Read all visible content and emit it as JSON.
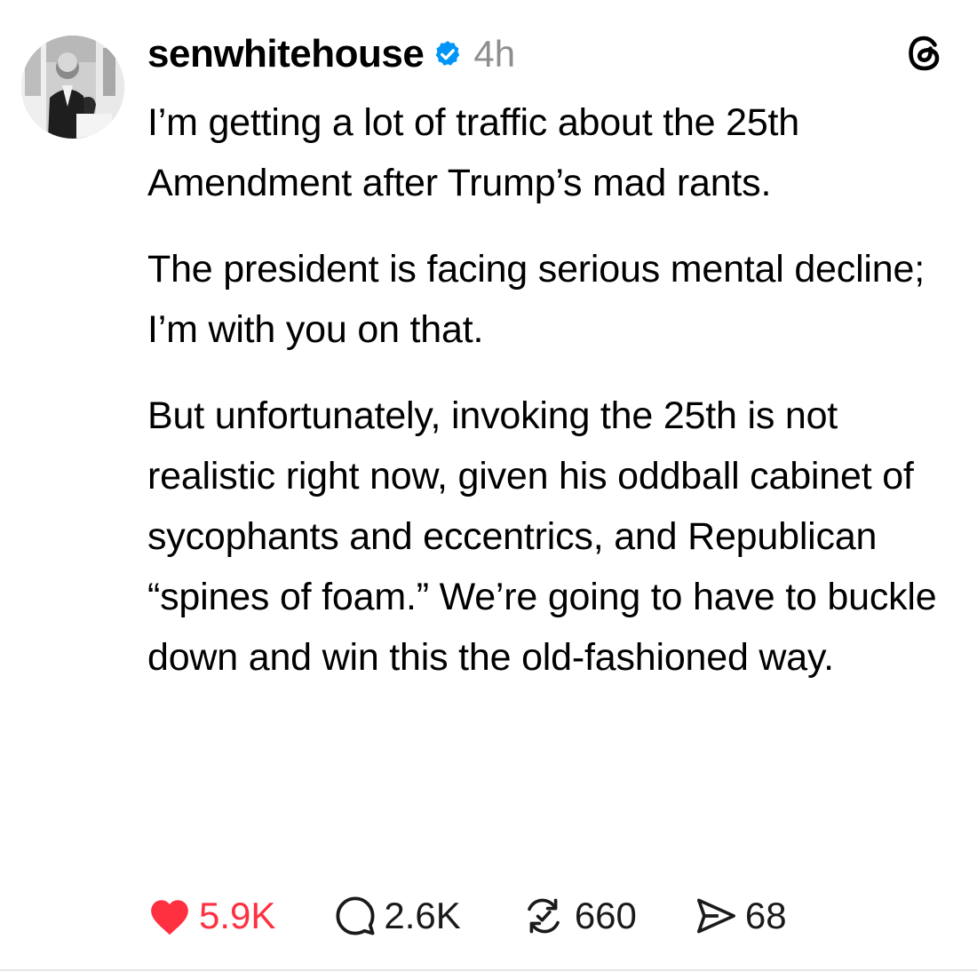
{
  "post": {
    "username": "senwhitehouse",
    "verified_icon": "verified-badge-icon",
    "verified_color": "#0095f6",
    "timestamp": "4h",
    "app_icon": "threads-logo-icon",
    "paragraphs": [
      "I’m getting a lot of traffic about the 25th Amendment after Trump’s mad rants.",
      "The president is facing serious mental decline; I’m with you on that.",
      "But unfortunately, invoking the 25th is not realistic right now, given his oddball cabinet of sycophants and eccentrics, and Republican “spines of foam.” We’re going to have to buckle down and win this the old-fashioned way."
    ]
  },
  "actions": {
    "like": {
      "icon": "heart-filled-icon",
      "count": "5.9K",
      "color": "#ff3040"
    },
    "reply": {
      "icon": "comment-icon",
      "count": "2.6K"
    },
    "repost": {
      "icon": "repost-icon",
      "count": "660"
    },
    "share": {
      "icon": "send-icon",
      "count": "68"
    }
  }
}
